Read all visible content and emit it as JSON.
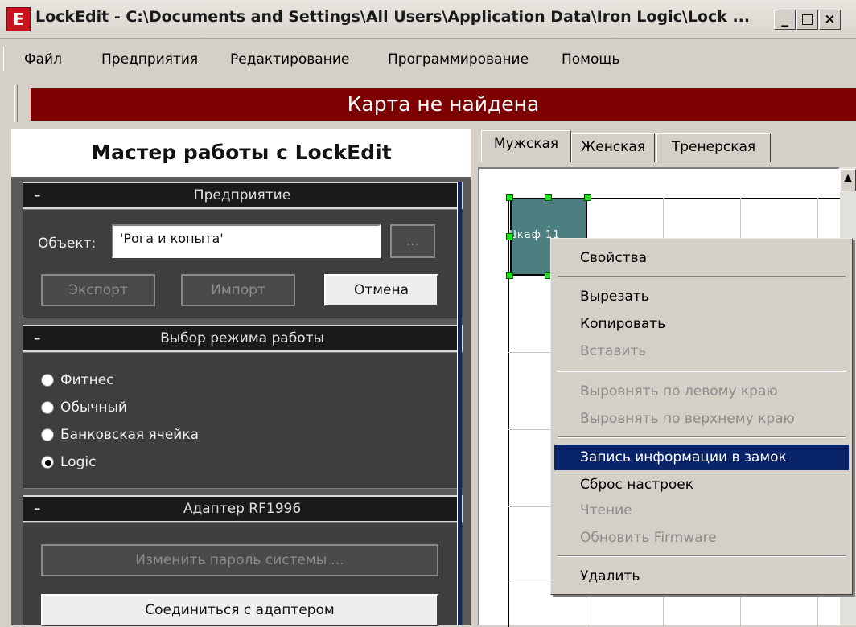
{
  "window": {
    "title": "LockEdit - C:\\Documents and Settings\\All Users\\Application Data\\Iron Logic\\Lock ...",
    "app_icon": "E",
    "minimize_glyph": "_",
    "maximize_glyph": "□",
    "close_glyph": "×"
  },
  "menu": {
    "items": [
      "Файл",
      "Предприятия",
      "Редактирование",
      "Программирование",
      "Помощь"
    ]
  },
  "status_banner": "Карта не найдена",
  "wizard": {
    "title": "Мастер работы с LockEdit",
    "enterprise": {
      "header": "Предприятие",
      "collapse_glyph": "–",
      "object_label": "Объект:",
      "object_value": "'Рога и копыта'",
      "browse_label": "...",
      "export_label": "Экспорт",
      "import_label": "Импорт",
      "cancel_label": "Отмена"
    },
    "mode": {
      "header": "Выбор режима работы",
      "collapse_glyph": "–",
      "options": [
        "Фитнес",
        "Обычный",
        "Банковская ячейка",
        "Logic"
      ],
      "selected": "Logic"
    },
    "adapter": {
      "header": "Адаптер RF1996",
      "collapse_glyph": "–",
      "change_password_label": "Изменить пароль системы ...",
      "connect_label": "Соединиться с адаптером"
    }
  },
  "tabs": [
    {
      "label": "Мужская",
      "active": true
    },
    {
      "label": "Женская",
      "active": false
    },
    {
      "label": "Тренерская",
      "active": false
    }
  ],
  "locker": {
    "label": "Шкаф 11"
  },
  "context_menu": {
    "items": [
      {
        "label": "Свойства",
        "enabled": true
      },
      {
        "label": "Вырезать",
        "enabled": true
      },
      {
        "label": "Копировать",
        "enabled": true
      },
      {
        "label": "Вставить",
        "enabled": false
      },
      {
        "label": "Выровнять по левому краю",
        "enabled": false
      },
      {
        "label": "Выровнять по верхнему краю",
        "enabled": false
      },
      {
        "label": "Запись информации в замок",
        "enabled": true,
        "highlighted": true
      },
      {
        "label": "Сброс настроек",
        "enabled": true
      },
      {
        "label": "Чтение",
        "enabled": false
      },
      {
        "label": "Обновить Firmware",
        "enabled": false
      },
      {
        "label": "Удалить",
        "enabled": true
      }
    ]
  },
  "colors": {
    "banner": "#7d0000",
    "highlight": "#0a246a",
    "locker_fill": "#4e7f80",
    "selection_handle": "#22dd22"
  }
}
